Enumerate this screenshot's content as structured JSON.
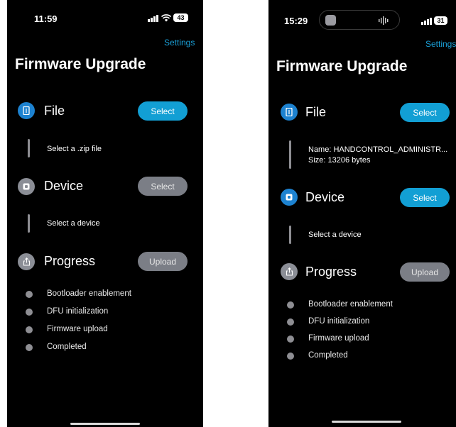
{
  "screen1": {
    "status": {
      "time": "11:59",
      "battery": "43"
    },
    "settings_label": "Settings",
    "title": "Firmware Upgrade",
    "file": {
      "label": "File",
      "button": "Select",
      "info": "Select a .zip file"
    },
    "device": {
      "label": "Device",
      "button": "Select",
      "info": "Select a device"
    },
    "progress": {
      "label": "Progress",
      "button": "Upload",
      "steps": [
        "Bootloader enablement",
        "DFU initialization",
        "Firmware upload",
        "Completed"
      ]
    }
  },
  "screen2": {
    "status": {
      "time": "15:29",
      "battery": "31"
    },
    "settings_label": "Settings",
    "title": "Firmware Upgrade",
    "file": {
      "label": "File",
      "button": "Select",
      "name_line": "Name: HANDCONTROL_ADMINISTR...",
      "size_line": "Size: 13206 bytes"
    },
    "device": {
      "label": "Device",
      "button": "Select",
      "info": "Select a device"
    },
    "progress": {
      "label": "Progress",
      "button": "Upload",
      "steps": [
        "Bootloader enablement",
        "DFU initialization",
        "Firmware upload",
        "Completed"
      ]
    }
  },
  "colors": {
    "accent": "#129fd4",
    "disabled": "#7b7e86",
    "background": "#000000"
  }
}
